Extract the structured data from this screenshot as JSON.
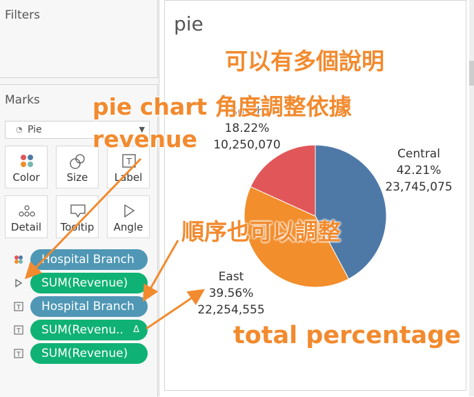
{
  "filters": {
    "title": "Filters"
  },
  "marks": {
    "title": "Marks",
    "mark_type": "Pie",
    "buttons": [
      {
        "label": "Color",
        "icon": "color-dots-icon"
      },
      {
        "label": "Size",
        "icon": "size-icon"
      },
      {
        "label": "Label",
        "icon": "text-label-icon"
      },
      {
        "label": "Detail",
        "icon": "detail-dots-icon"
      },
      {
        "label": "Tooltip",
        "icon": "tooltip-icon"
      },
      {
        "label": "Angle",
        "icon": "angle-icon"
      }
    ],
    "shelf": [
      {
        "icon": "color-dots-icon",
        "pill": "Hospital Branch",
        "kind": "dimension"
      },
      {
        "icon": "angle-icon",
        "pill": "SUM(Revenue)",
        "kind": "measure"
      },
      {
        "icon": "text-label-icon",
        "pill": "Hospital Branch",
        "kind": "dimension"
      },
      {
        "icon": "text-label-icon",
        "pill": "SUM(Revenu..",
        "kind": "measure",
        "badge": "Δ"
      },
      {
        "icon": "text-label-icon",
        "pill": "SUM(Revenue)",
        "kind": "measure"
      }
    ]
  },
  "view": {
    "title": "pie"
  },
  "chart_data": {
    "type": "pie",
    "title": "pie",
    "slices": [
      {
        "label": "Central",
        "percent": "42.21%",
        "value": 23745075,
        "value_text": "23,745,075",
        "color": "#4e79a7"
      },
      {
        "label": "East",
        "percent": "39.56%",
        "value": 22254555,
        "value_text": "22,254,555",
        "color": "#f28e2b"
      },
      {
        "label": "South",
        "percent": "18.22%",
        "value": 10250070,
        "value_text": "10,250,070",
        "color": "#e15759"
      }
    ]
  },
  "annotations": {
    "note1": "可以有多個說明",
    "note2_line1": "pie chart 角度調整依據",
    "note2_line2": "revenue",
    "note3": "順序也可以調整",
    "note4": "total percentage"
  },
  "colors": {
    "accent": "#f28a2e",
    "dimension_pill": "#4f97b5",
    "measure_pill": "#0fb274"
  }
}
